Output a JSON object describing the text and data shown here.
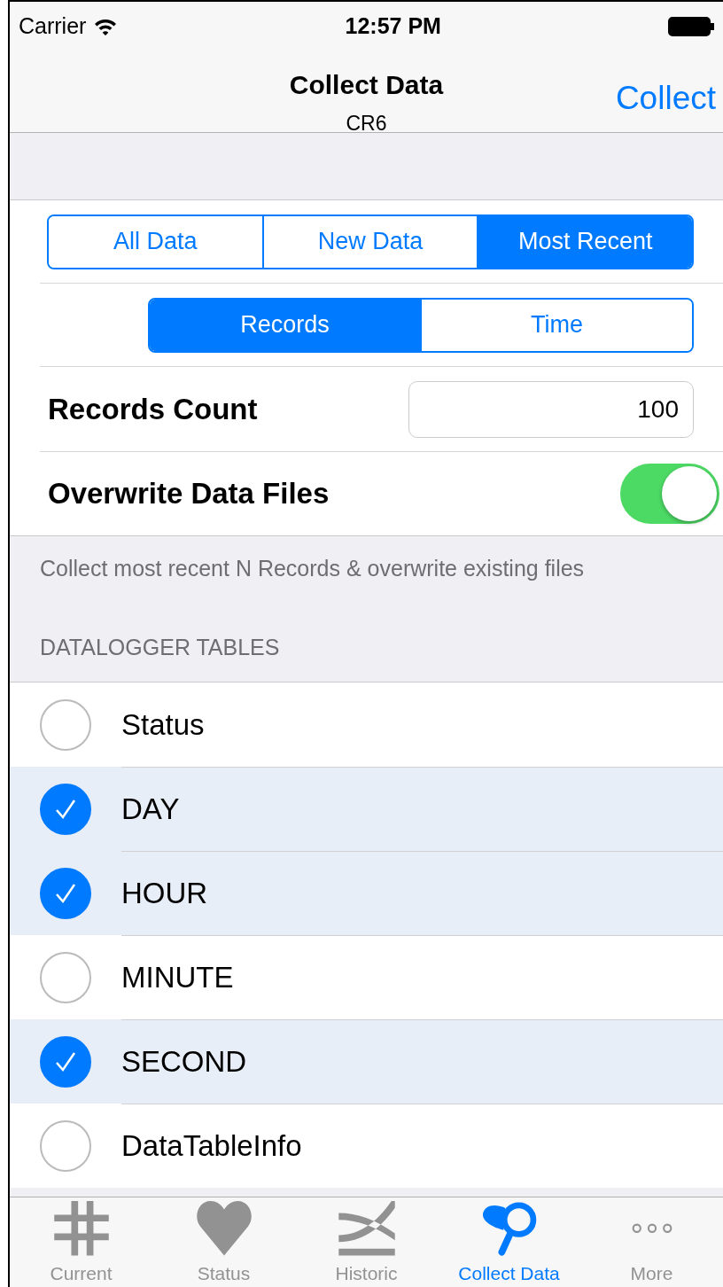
{
  "status_bar": {
    "carrier": "Carrier",
    "time": "12:57 PM"
  },
  "nav_bar": {
    "title": "Collect Data",
    "subtitle": "CR6",
    "action": "Collect"
  },
  "mode_segments": [
    {
      "label": "All Data",
      "selected": false
    },
    {
      "label": "New Data",
      "selected": false
    },
    {
      "label": "Most Recent",
      "selected": true
    }
  ],
  "unit_segments": [
    {
      "label": "Records",
      "selected": true
    },
    {
      "label": "Time",
      "selected": false
    }
  ],
  "records_count": {
    "label": "Records Count",
    "value": "100"
  },
  "overwrite": {
    "label": "Overwrite Data Files",
    "on": true
  },
  "footer_note": "Collect most recent N Records & overwrite existing files",
  "tables_header": "DATALOGGER TABLES",
  "tables": [
    {
      "name": "Status",
      "checked": false
    },
    {
      "name": "DAY",
      "checked": true
    },
    {
      "name": "HOUR",
      "checked": true
    },
    {
      "name": "MINUTE",
      "checked": false
    },
    {
      "name": "SECOND",
      "checked": true
    },
    {
      "name": "DataTableInfo",
      "checked": false
    }
  ],
  "tab_bar": [
    {
      "label": "Current",
      "kind": "grid",
      "selected": false
    },
    {
      "label": "Status",
      "kind": "heart",
      "selected": false
    },
    {
      "label": "Historic",
      "kind": "curves",
      "selected": false
    },
    {
      "label": "Collect Data",
      "kind": "net",
      "selected": true
    },
    {
      "label": "More",
      "kind": "dots",
      "selected": false
    }
  ]
}
